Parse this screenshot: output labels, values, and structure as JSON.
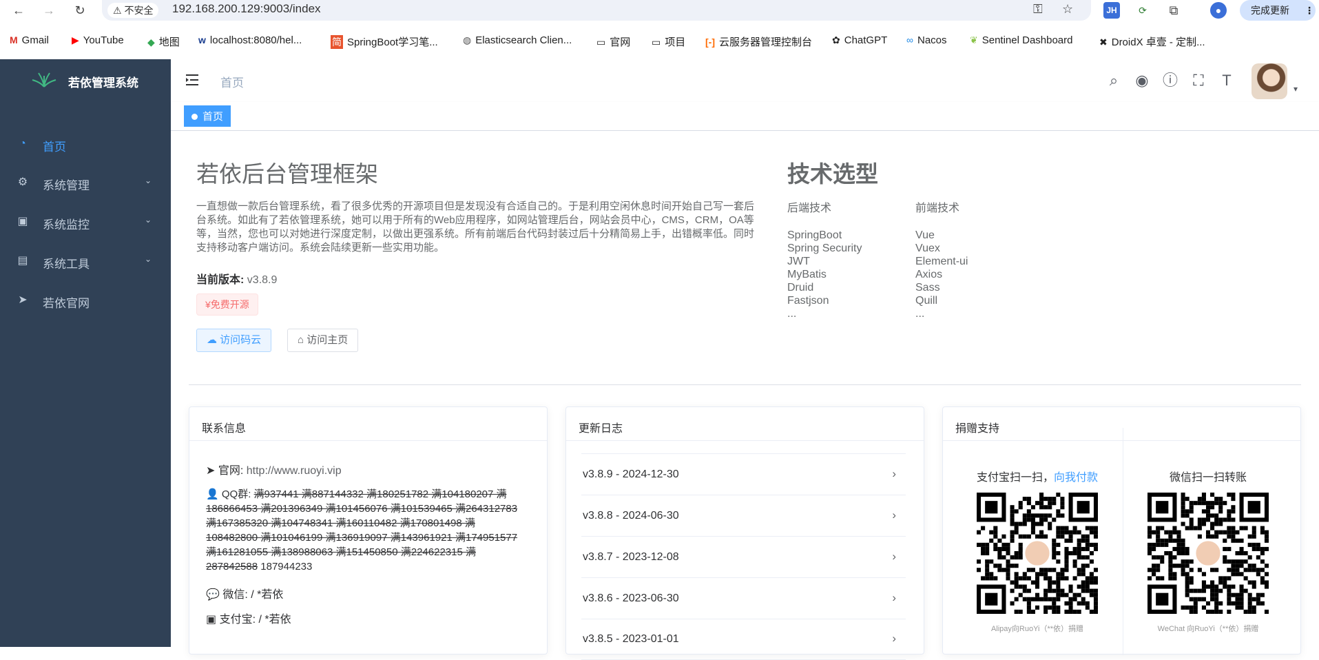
{
  "browser": {
    "security_label": "不安全",
    "url": "192.168.200.129:9003/index",
    "update_label": "完成更新",
    "ext_jh": "JH",
    "bookmarks": [
      "Gmail",
      "YouTube",
      "地图",
      "localhost:8080/hel...",
      "SpringBoot学习笔...",
      "Elasticsearch Clien...",
      "官网",
      "项目",
      "云服务器管理控制台",
      "ChatGPT",
      "Nacos",
      "Sentinel Dashboard",
      "DroidX 卓壹 - 定制..."
    ]
  },
  "sidebar": {
    "logo": "若依管理系统",
    "items": [
      {
        "label": "首页",
        "icon": "dashboard-icon"
      },
      {
        "label": "系统管理",
        "icon": "gear-icon"
      },
      {
        "label": "系统监控",
        "icon": "monitor-icon"
      },
      {
        "label": "系统工具",
        "icon": "toolbox-icon"
      },
      {
        "label": "若依官网",
        "icon": "paper-plane-icon"
      }
    ]
  },
  "navbar": {
    "breadcrumb": "首页"
  },
  "tagsview": {
    "active": "首页"
  },
  "intro": {
    "title": "若依后台管理框架",
    "text": "一直想做一款后台管理系统，看了很多优秀的开源项目但是发现没有合适自己的。于是利用空闲休息时间开始自己写一套后台系统。如此有了若依管理系统，她可以用于所有的Web应用程序，如网站管理后台，网站会员中心，CMS，CRM，OA等等，当然，您也可以对她进行深度定制，以做出更强系统。所有前端后台代码封装过后十分精简易上手，出错概率低。同时支持移动客户端访问。系统会陆续更新一些实用功能。",
    "version_label": "当前版本:",
    "version": "v3.8.9",
    "free_tag": "¥免费开源",
    "btn_gitee": "访问码云",
    "btn_home": "访问主页"
  },
  "tech": {
    "title": "技术选型",
    "backend_head": "后端技术",
    "frontend_head": "前端技术",
    "backend": [
      "SpringBoot",
      "Spring Security",
      "JWT",
      "MyBatis",
      "Druid",
      "Fastjson",
      "..."
    ],
    "frontend": [
      "Vue",
      "Vuex",
      "Element-ui",
      "Axios",
      "Sass",
      "Quill",
      "..."
    ]
  },
  "contact": {
    "title": "联系信息",
    "site_label": "官网:",
    "site": "http://www.ruoyi.vip",
    "qq_label": "QQ群:",
    "qq_struck": "满937441 满887144332 满180251782 满104180207 满186866453 满201396349 满101456076 满101539465 满264312783 满167385320 满104748341 满160110482 满170801498 满108482800 满101046199 满136919097 满143961921 满174951577 满161281055 满138988063 满151450850 满224622315 满287842588",
    "qq_active": "187944233",
    "wechat_label": "微信:",
    "wechat": "/ *若依",
    "alipay_label": "支付宝:",
    "alipay": "/ *若依"
  },
  "changelog": {
    "title": "更新日志",
    "items": [
      "v3.8.9 - 2024-12-30",
      "v3.8.8 - 2024-06-30",
      "v3.8.7 - 2023-12-08",
      "v3.8.6 - 2023-06-30",
      "v3.8.5 - 2023-01-01"
    ]
  },
  "donate": {
    "title": "捐赠支持",
    "alipay_title": "支付宝扫一扫，",
    "alipay_link": "向我付款",
    "alipay_caption": "Alipay向RuoYi（**依）捐赠",
    "wechat_title": "微信扫一扫转账",
    "wechat_caption": "WeChat 向RuoYi（**依）捐赠"
  }
}
